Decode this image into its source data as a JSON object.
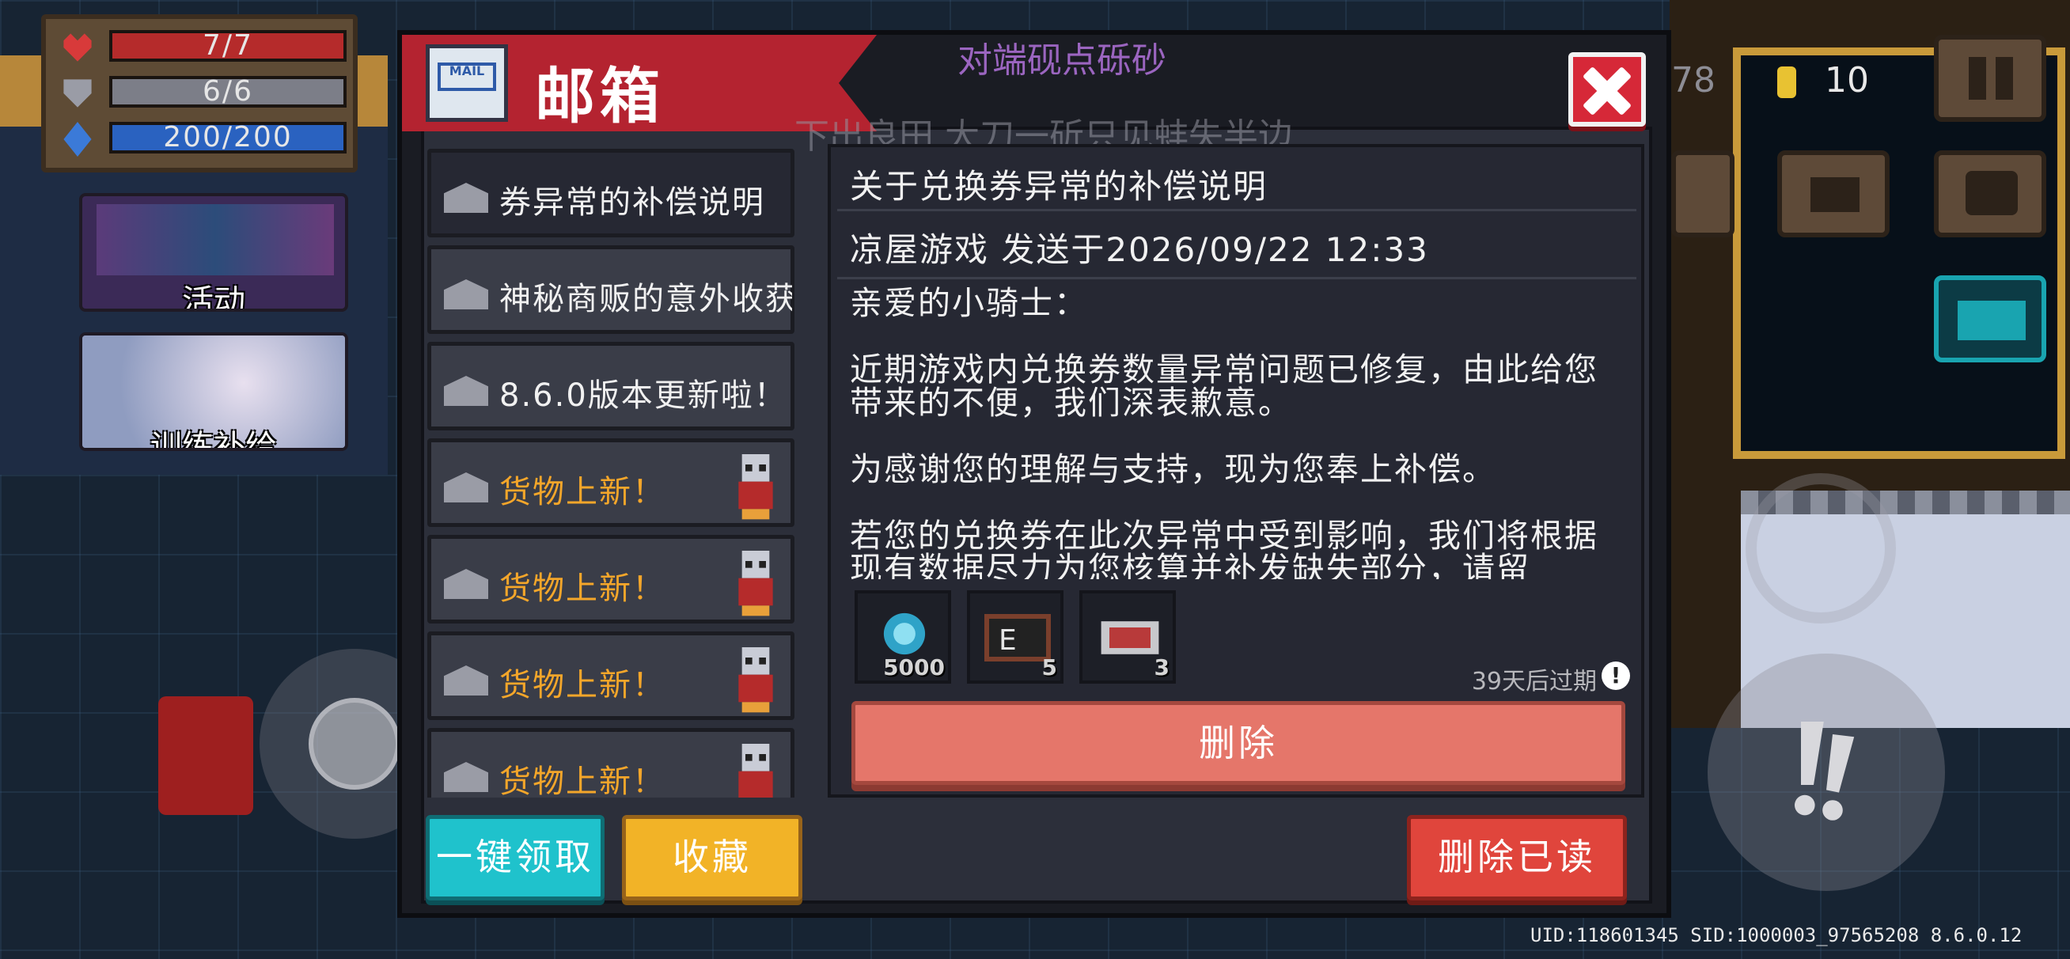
{
  "hud": {
    "hp": "7/7",
    "armor": "6/6",
    "energy": "200/200",
    "activity_label": "活动",
    "training_label": "训练补给",
    "gem_count_partial": "78",
    "coin_count": "10"
  },
  "overlay": {
    "line1": "对端砚点砾砂",
    "line2": "下出良田 大刀一斫只见蚌失半边"
  },
  "mailbox": {
    "title": "邮箱",
    "mails": [
      {
        "label": "关于兑换券异常的补偿说明",
        "display": "券异常的补偿说明",
        "style": "normal",
        "selected": true,
        "npc": false
      },
      {
        "label": "神秘商贩的意外收获",
        "display": "神秘商贩的意外收获",
        "style": "normal",
        "selected": false,
        "npc": false
      },
      {
        "label": "8.6.0版本更新啦！",
        "display": "8.6.0版本更新啦！",
        "style": "normal",
        "selected": false,
        "npc": false
      },
      {
        "label": "货物上新！",
        "display": "货物上新！",
        "style": "gold",
        "selected": false,
        "npc": true
      },
      {
        "label": "货物上新！",
        "display": "货物上新！",
        "style": "gold",
        "selected": false,
        "npc": true
      },
      {
        "label": "货物上新！",
        "display": "货物上新！",
        "style": "gold",
        "selected": false,
        "npc": true
      },
      {
        "label": "货物上新！",
        "display": "货物上新！",
        "style": "gold",
        "selected": false,
        "npc": true
      }
    ],
    "detail": {
      "title": "关于兑换券异常的补偿说明",
      "sender": "凉屋游戏 发送于2026/09/22 12:33",
      "greeting": "亲爱的小骑士：",
      "para1": "近期游戏内兑换券数量异常问题已修复，由此给您带来的不便，我们深表歉意。",
      "para2": "为感谢您的理解与支持，现为您奉上补偿。",
      "para3": "若您的兑换券在此次异常中受到影响，我们将根据现有数据尽力为您核算并补发缺失部分，请留",
      "rewards": [
        {
          "icon": "gem-icon",
          "qty": "5000"
        },
        {
          "icon": "exchange-ticket-icon",
          "qty": "5"
        },
        {
          "icon": "coupon-icon",
          "qty": "3"
        }
      ],
      "expire": "39天后过期",
      "delete_label": "删除"
    },
    "claim_all_label": "一键领取",
    "favorite_label": "收藏",
    "delete_read_label": "删除已读"
  },
  "footer": {
    "uid": "UID:118601345 SID:1000003_97565208 8.6.0.12"
  },
  "colors": {
    "banner_red": "#b42330",
    "close_red": "#d62838",
    "delete_salmon": "#e5766a",
    "claim_cyan": "#1fc2cc",
    "favorite_yellow": "#f2b327",
    "delete_read_red": "#e0453c",
    "gold_text": "#f4a62a"
  }
}
